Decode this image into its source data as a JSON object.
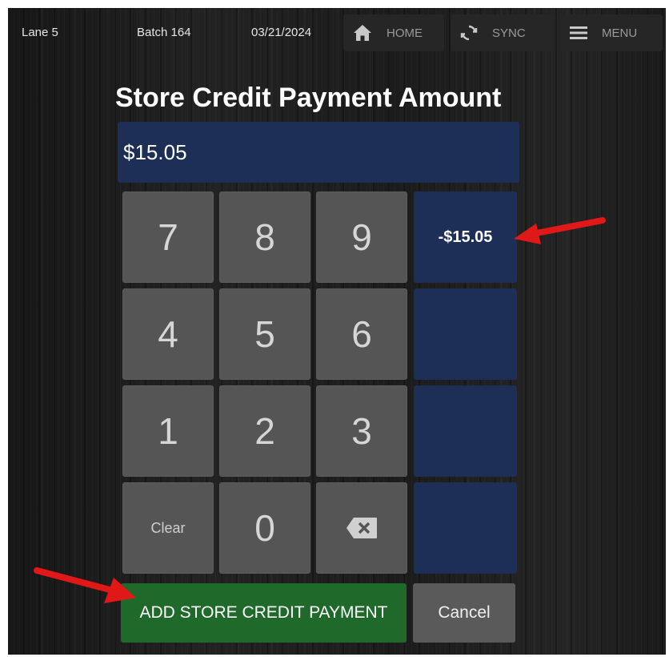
{
  "header": {
    "lane": "Lane 5",
    "batch": "Batch 164",
    "date": "03/21/2024",
    "home_label": "HOME",
    "sync_label": "SYNC",
    "menu_label": "MENU"
  },
  "title": "Store Credit Payment Amount",
  "amount_field": {
    "value": "$15.05"
  },
  "keypad": {
    "keys": [
      "7",
      "8",
      "9",
      "4",
      "5",
      "6",
      "1",
      "2",
      "3",
      "Clear",
      "0"
    ]
  },
  "quick_amounts": [
    "-$15.05",
    "",
    "",
    ""
  ],
  "actions": {
    "add_label": "ADD STORE CREDIT PAYMENT",
    "cancel_label": "Cancel"
  },
  "colors": {
    "accent_blue": "#1d2f57",
    "key_gray": "#555555",
    "add_green": "#1f6a2a",
    "annotation_red": "#e01818"
  },
  "icons": [
    "home-icon",
    "sync-icon",
    "menu-icon",
    "backspace-icon"
  ]
}
